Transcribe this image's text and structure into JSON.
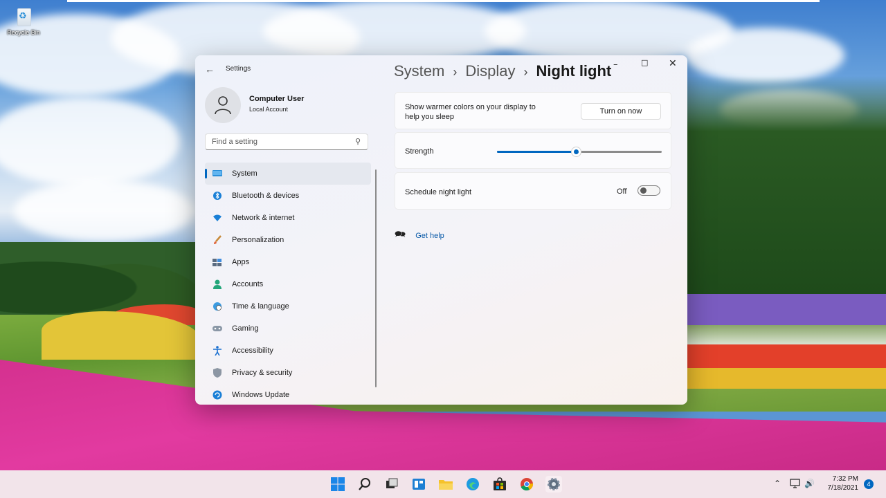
{
  "desktop": {
    "recycle_bin_label": "Recycle Bin"
  },
  "window": {
    "app_title": "Settings",
    "back_icon": "back-arrow-icon",
    "controls": {
      "minimize": "–",
      "maximize": "□",
      "close": "✕"
    }
  },
  "user": {
    "name": "Computer User",
    "account": "Local Account"
  },
  "search": {
    "placeholder": "Find a setting",
    "value": ""
  },
  "nav": {
    "items": [
      {
        "label": "System",
        "icon": "display-icon",
        "active": true
      },
      {
        "label": "Bluetooth & devices",
        "icon": "bluetooth-icon"
      },
      {
        "label": "Network & internet",
        "icon": "wifi-icon"
      },
      {
        "label": "Personalization",
        "icon": "brush-icon"
      },
      {
        "label": "Apps",
        "icon": "apps-icon"
      },
      {
        "label": "Accounts",
        "icon": "person-icon"
      },
      {
        "label": "Time & language",
        "icon": "globe-clock-icon"
      },
      {
        "label": "Gaming",
        "icon": "gamepad-icon"
      },
      {
        "label": "Accessibility",
        "icon": "accessibility-icon"
      },
      {
        "label": "Privacy & security",
        "icon": "shield-icon"
      },
      {
        "label": "Windows Update",
        "icon": "update-icon"
      }
    ]
  },
  "breadcrumb": {
    "level1": "System",
    "level2": "Display",
    "current": "Night light",
    "separator": "›"
  },
  "night_light": {
    "description_line1": "Show warmer colors on your display to",
    "description_line2": "help you sleep",
    "turn_on_label": "Turn on now",
    "strength_label": "Strength",
    "strength_value": 0.48,
    "schedule_label": "Schedule night light",
    "schedule_state": "Off"
  },
  "help": {
    "label": "Get help"
  },
  "taskbar": {
    "icons": [
      "windows-start-icon",
      "search-icon",
      "task-view-icon",
      "widgets-icon",
      "file-explorer-icon",
      "edge-icon",
      "store-icon",
      "chrome-icon",
      "settings-gear-icon"
    ],
    "time": "7:32 PM",
    "date": "7/18/2021",
    "notification_count": "4"
  },
  "colors": {
    "accent": "#0067c0",
    "taskbar": "#f2e4ea"
  }
}
